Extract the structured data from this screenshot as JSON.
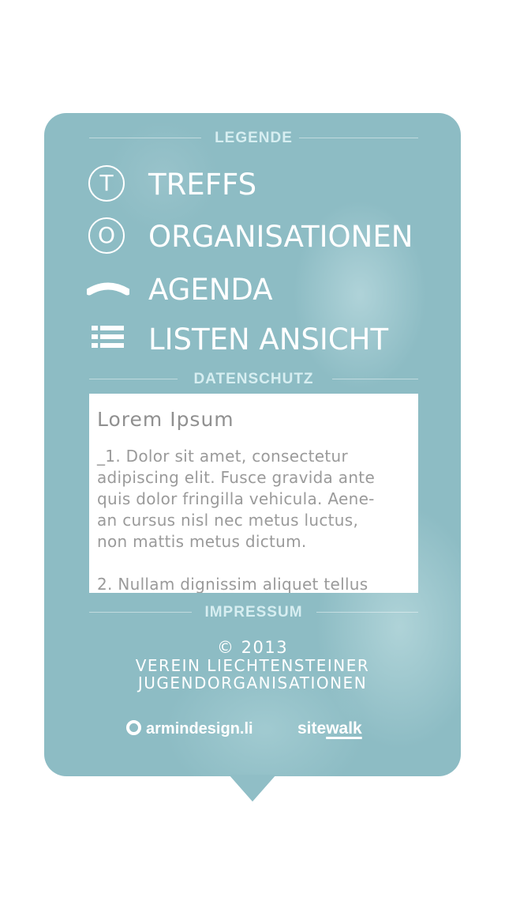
{
  "sections": {
    "legend_label": "LEGENDE",
    "privacy_label": "DATENSCHUTZ",
    "imprint_label": "IMPRESSUM"
  },
  "legend": {
    "items": [
      {
        "label": "TREFFS",
        "icon": "circle-t-icon",
        "glyph": "T"
      },
      {
        "label": "ORGANISATIONEN",
        "icon": "circle-o-icon",
        "glyph": "O"
      },
      {
        "label": "AGENDA",
        "icon": "arc-icon"
      },
      {
        "label": "LISTEN ANSICHT",
        "icon": "list-icon"
      }
    ]
  },
  "privacy": {
    "title": "Lorem Ipsum",
    "body": "_1. Dolor sit amet, consectetur\nadipiscing elit. Fusce gravida ante\nquis dolor fringilla vehicula. Aene-\nan cursus nisl nec metus luctus,\nnon mattis metus dictum.\n\n  2. Nullam dignissim aliquet tellus"
  },
  "imprint": {
    "copyright": "© 2013",
    "org_line1": "VEREIN LIECHTENSTEINER",
    "org_line2": "JUGENDORGANISATIONEN"
  },
  "credits": {
    "armin": "armindesign.li",
    "sitewalk_a": "site",
    "sitewalk_b": "walk"
  },
  "colors": {
    "card_bg": "#8dbcc4",
    "section_label": "#d7eef1",
    "text": "#ffffff"
  }
}
